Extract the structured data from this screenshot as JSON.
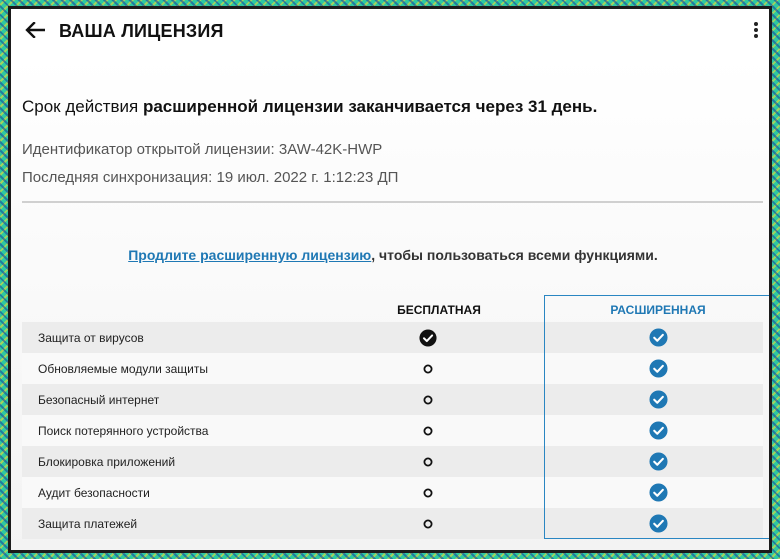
{
  "appbar": {
    "title": "ВАША ЛИЦЕНЗИЯ"
  },
  "license": {
    "expiry_prefix": "Срок действия ",
    "expiry_bold": "расширенной лицензии заканчивается через 31 день.",
    "id_line": "Идентификатор открытой лицензии: 3AW-42K-HWP",
    "sync_line": "Последняя синхронизация: 19 июл. 2022 г. 1:12:23 ДП"
  },
  "promo": {
    "link_text": "Продлите расширенную лицензию",
    "rest_text": ", чтобы пользоваться всеми функциями."
  },
  "table": {
    "headers": {
      "free": "БЕСПЛАТНАЯ",
      "premium": "РАСШИРЕННАЯ"
    },
    "rows": [
      {
        "label": "Защита от вирусов",
        "free": "check",
        "premium": "check"
      },
      {
        "label": "Обновляемые модули защиты",
        "free": "circle",
        "premium": "check"
      },
      {
        "label": "Безопасный интернет",
        "free": "circle",
        "premium": "check"
      },
      {
        "label": "Поиск потерянного устройства",
        "free": "circle",
        "premium": "check"
      },
      {
        "label": "Блокировка приложений",
        "free": "circle",
        "premium": "check"
      },
      {
        "label": "Аудит безопасности",
        "free": "circle",
        "premium": "check"
      },
      {
        "label": "Защита платежей",
        "free": "circle",
        "premium": "check"
      }
    ]
  },
  "colors": {
    "accent": "#1f78b4",
    "check_free": "#111111",
    "check_premium": "#1f78b4"
  },
  "icons": {
    "back": "arrow-left-icon",
    "menu": "more-vert-icon"
  }
}
